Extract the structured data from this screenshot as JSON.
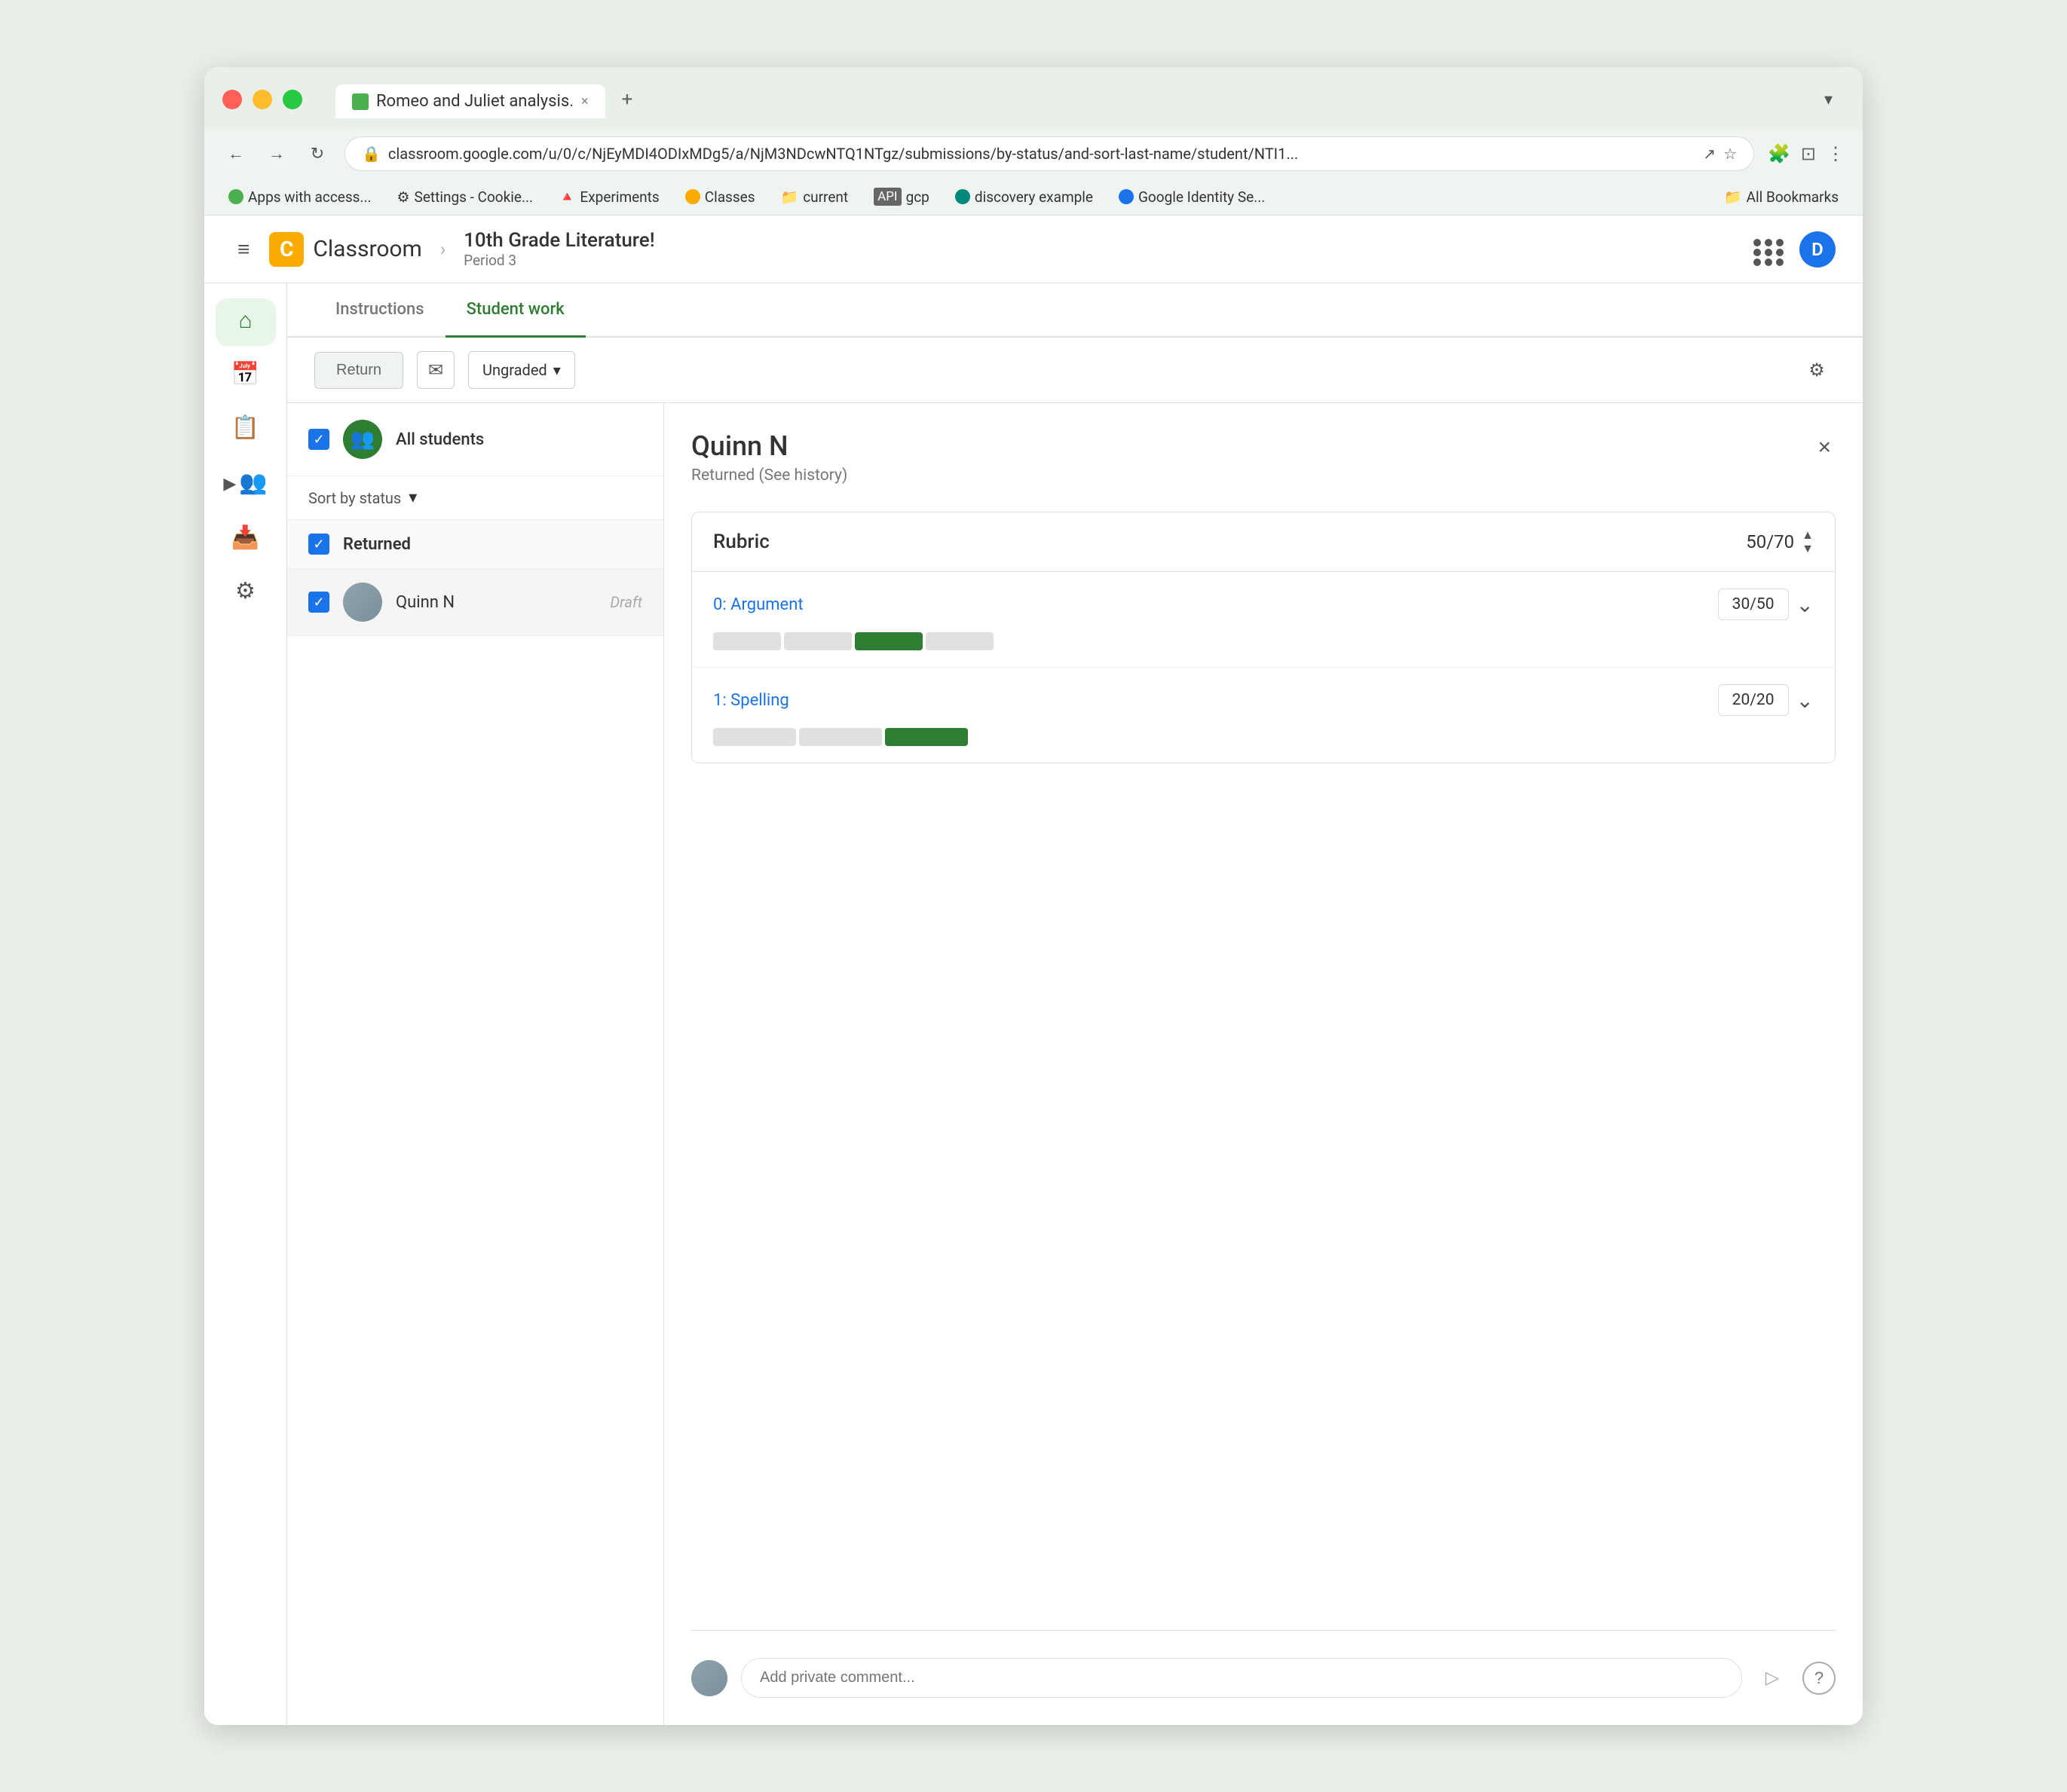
{
  "browser": {
    "tab_title": "Romeo and Juliet analysis.",
    "url": "classroom.google.com/u/0/c/NjEyMDI4ODIxMDg5/a/NjM3NDcwNTQ1NTgz/submissions/by-status/and-sort-last-name/student/NTI1...",
    "new_tab_icon": "+",
    "dropdown_icon": "▾",
    "bookmarks": [
      {
        "label": "Apps with access...",
        "icon_type": "green"
      },
      {
        "label": "Settings - Cookie...",
        "icon_type": "gear"
      },
      {
        "label": "Experiments",
        "icon_type": "person"
      },
      {
        "label": "Classes",
        "icon_type": "yellow"
      },
      {
        "label": "current",
        "icon_type": "folder"
      },
      {
        "label": "gcp",
        "icon_type": "api"
      },
      {
        "label": "discovery example",
        "icon_type": "teal"
      },
      {
        "label": "Google Identity Se...",
        "icon_type": "blue"
      },
      {
        "label": "All Bookmarks",
        "icon_type": "folder"
      }
    ]
  },
  "app": {
    "logo_letter": "C",
    "logo_name": "Classroom",
    "breadcrumb_course": "10th Grade Literature!",
    "breadcrumb_period": "Period 3",
    "user_initial": "D"
  },
  "tabs": {
    "instructions": "Instructions",
    "student_work": "Student work"
  },
  "toolbar": {
    "return_label": "Return",
    "grade_label": "Ungraded"
  },
  "student_list": {
    "all_students_label": "All students",
    "sort_label": "Sort by status",
    "section_returned": "Returned",
    "student_name": "Quinn N",
    "student_status": "Draft"
  },
  "detail": {
    "student_name": "Quinn N",
    "student_status": "Returned (See history)",
    "rubric_title": "Rubric",
    "rubric_total": "50/70",
    "criterion_1_name": "0: Argument",
    "criterion_1_score": "30/50",
    "criterion_1_segments": [
      {
        "type": "inactive"
      },
      {
        "type": "inactive"
      },
      {
        "type": "active"
      },
      {
        "type": "inactive"
      }
    ],
    "criterion_2_name": "1: Spelling",
    "criterion_2_score": "20/20",
    "criterion_2_segments": [
      {
        "type": "inactive"
      },
      {
        "type": "inactive"
      },
      {
        "type": "active"
      }
    ],
    "comment_placeholder": "Add private comment..."
  },
  "icons": {
    "home": "⌂",
    "calendar": "📅",
    "assignment": "📋",
    "people": "👥",
    "archive": "📥",
    "settings": "⚙",
    "hamburger": "≡",
    "apps": "⊞",
    "back": "←",
    "forward": "→",
    "refresh": "↻",
    "lock": "🔒",
    "star": "☆",
    "extensions": "🧩",
    "more": "⋮",
    "close": "×",
    "chevron_down": "▾",
    "expand": "⌄",
    "send": "▷",
    "help": "?",
    "gear": "⚙",
    "email": "✉",
    "check": "✓",
    "up_down": "⇅",
    "shield": "🛡"
  }
}
